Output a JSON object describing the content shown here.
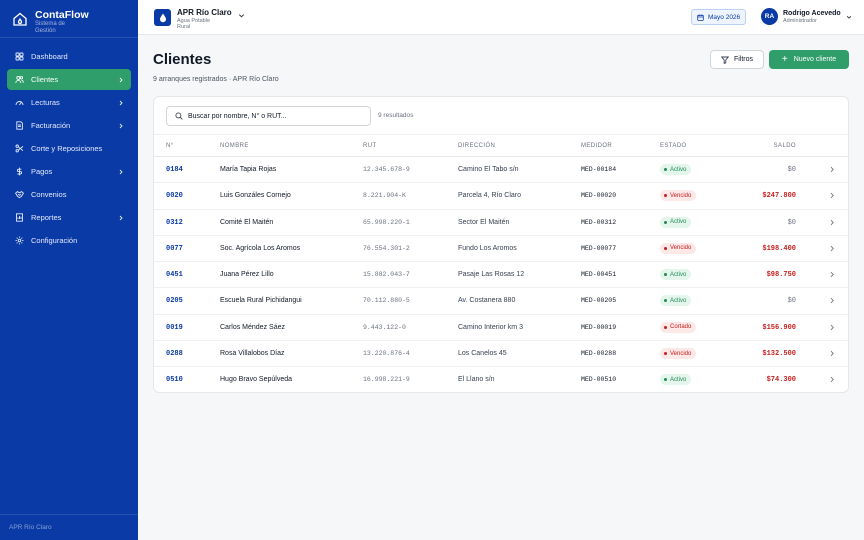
{
  "app": {
    "name": "ContaFlow",
    "subtitle": "Sistema de Gestión",
    "footer": "APR Río Claro"
  },
  "sidebar": {
    "items": [
      {
        "label": "Dashboard",
        "icon": "grid-icon",
        "chevron": false,
        "active": false
      },
      {
        "label": "Clientes",
        "icon": "users-icon",
        "chevron": true,
        "active": true
      },
      {
        "label": "Lecturas",
        "icon": "gauge-icon",
        "chevron": true,
        "active": false
      },
      {
        "label": "Facturación",
        "icon": "invoice-icon",
        "chevron": true,
        "active": false
      },
      {
        "label": "Corte y Reposiciones",
        "icon": "scissors-icon",
        "chevron": false,
        "active": false
      },
      {
        "label": "Pagos",
        "icon": "dollar-icon",
        "chevron": true,
        "active": false
      },
      {
        "label": "Convenios",
        "icon": "handshake-icon",
        "chevron": false,
        "active": false
      },
      {
        "label": "Reportes",
        "icon": "report-icon",
        "chevron": true,
        "active": false
      },
      {
        "label": "Configuración",
        "icon": "gear-icon",
        "chevron": false,
        "active": false
      }
    ]
  },
  "topbar": {
    "org_name": "APR Río Claro",
    "org_sub": "Agua Potable Rural",
    "period": "Mayo 2026",
    "user_initials": "RA",
    "user_name": "Rodrigo Acevedo",
    "user_role": "Administrador"
  },
  "page": {
    "title": "Clientes",
    "subtitle": "9 arranques registrados · APR Río Claro",
    "filter_label": "Filtros",
    "new_label": "Nuevo cliente"
  },
  "search": {
    "placeholder": "Buscar por nombre, N° o RUT...",
    "count": "9 resultados"
  },
  "table": {
    "headers": {
      "num": "N°",
      "name": "NOMBRE",
      "rut": "RUT",
      "dir": "DIRECCIÓN",
      "med": "MEDIDOR",
      "est": "ESTADO",
      "saldo": "SALDO"
    },
    "rows": [
      {
        "num": "0184",
        "name": "María Tapia Rojas",
        "rut": "12.345.678-9",
        "dir": "Camino El Tabo s/n",
        "med": "MED-00184",
        "estado": "Activo",
        "saldo": "$0"
      },
      {
        "num": "0020",
        "name": "Luis Gonzáles Cornejo",
        "rut": "8.221.904-K",
        "dir": "Parcela 4, Río Claro",
        "med": "MED-00020",
        "estado": "Vencido",
        "saldo": "$247.800"
      },
      {
        "num": "0312",
        "name": "Comité El Maitén",
        "rut": "65.998.220-1",
        "dir": "Sector El Maitén",
        "med": "MED-00312",
        "estado": "Activo",
        "saldo": "$0"
      },
      {
        "num": "0077",
        "name": "Soc. Agrícola Los Aromos",
        "rut": "76.554.301-2",
        "dir": "Fundo Los Aromos",
        "med": "MED-00077",
        "estado": "Vencido",
        "saldo": "$198.400"
      },
      {
        "num": "0451",
        "name": "Juana Pérez Lillo",
        "rut": "15.882.043-7",
        "dir": "Pasaje Las Rosas 12",
        "med": "MED-00451",
        "estado": "Activo",
        "saldo": "$98.750"
      },
      {
        "num": "0205",
        "name": "Escuela Rural Pichidangui",
        "rut": "70.112.880-5",
        "dir": "Av. Costanera 880",
        "med": "MED-00205",
        "estado": "Activo",
        "saldo": "$0"
      },
      {
        "num": "0019",
        "name": "Carlos Méndez Sáez",
        "rut": "9.443.122-0",
        "dir": "Camino Interior km 3",
        "med": "MED-00019",
        "estado": "Cortado",
        "saldo": "$156.900"
      },
      {
        "num": "0288",
        "name": "Rosa Villalobos Díaz",
        "rut": "13.220.876-4",
        "dir": "Los Canelos 45",
        "med": "MED-00288",
        "estado": "Vencido",
        "saldo": "$132.500"
      },
      {
        "num": "0510",
        "name": "Hugo Bravo Sepúlveda",
        "rut": "16.998.221-9",
        "dir": "El Llano s/n",
        "med": "MED-00510",
        "estado": "Activo",
        "saldo": "$74.300"
      }
    ]
  },
  "colors": {
    "sidebar_bg": "#0a3aa6",
    "accent_green": "#2f9e6b",
    "debt_red": "#c81e1e"
  }
}
